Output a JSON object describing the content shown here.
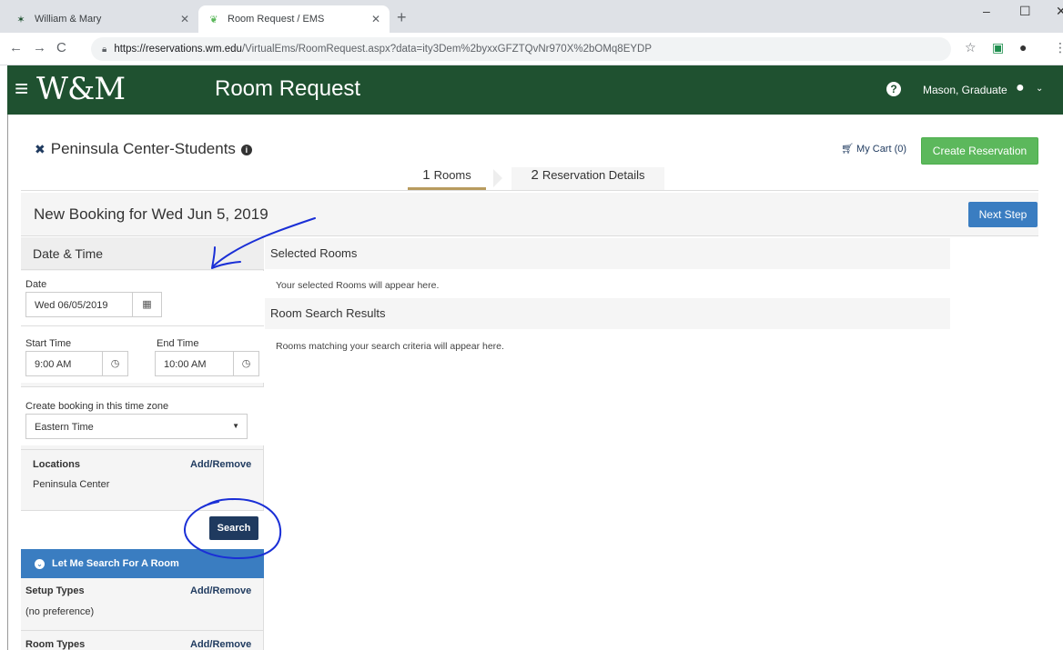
{
  "browser": {
    "tabs": [
      {
        "title": "William & Mary",
        "active": false
      },
      {
        "title": "Room Request / EMS",
        "active": true
      }
    ],
    "url_host": "https://reservations.wm.edu",
    "url_path": "/VirtualEms/RoomRequest.aspx?data=ity3Dem%2byxxGFZTQvNr970X%2bOMq8EYDP"
  },
  "header": {
    "logo": "W&M",
    "title": "Room Request",
    "user": "Mason, Graduate"
  },
  "page": {
    "template_title": "Peninsula Center-Students",
    "cart": "My Cart (0)",
    "create_button": "Create Reservation",
    "steps": [
      {
        "num": "1",
        "label": "Rooms"
      },
      {
        "num": "2",
        "label": "Reservation Details"
      }
    ],
    "booking_title": "New Booking for Wed Jun 5, 2019",
    "next_button": "Next Step"
  },
  "panel": {
    "heading": "Date & Time",
    "date_label": "Date",
    "date_value": "Wed 06/05/2019",
    "start_label": "Start Time",
    "start_value": "9:00 AM",
    "end_label": "End Time",
    "end_value": "10:00 AM",
    "tz_label": "Create booking in this time zone",
    "tz_value": "Eastern Time",
    "locations_label": "Locations",
    "locations_link": "Add/Remove",
    "locations_value": "Peninsula Center",
    "search_button": "Search",
    "let_me_search": "Let Me Search For A Room",
    "setup_label": "Setup Types",
    "setup_link": "Add/Remove",
    "setup_value": "(no preference)",
    "roomtypes_label": "Room Types",
    "roomtypes_link": "Add/Remove"
  },
  "content": {
    "selected_heading": "Selected Rooms",
    "selected_text": "Your selected Rooms will appear here.",
    "results_heading": "Room Search Results",
    "results_text": "Rooms matching your search criteria will appear here."
  },
  "colors": {
    "header_green": "#1f5130",
    "create_green": "#5cb85c",
    "primary_blue": "#3a7dc1",
    "navy": "#1f3a5f",
    "step_gold": "#b89b5e",
    "annotation_blue": "#1a2fd6"
  },
  "icons": [
    "wm-favicon",
    "ems-favicon",
    "lock-icon",
    "star-icon",
    "hamburger-icon",
    "help-icon",
    "user-icon",
    "close-icon",
    "info-icon",
    "cart-icon",
    "calendar-icon",
    "clock-icon",
    "chevron-down-icon"
  ]
}
